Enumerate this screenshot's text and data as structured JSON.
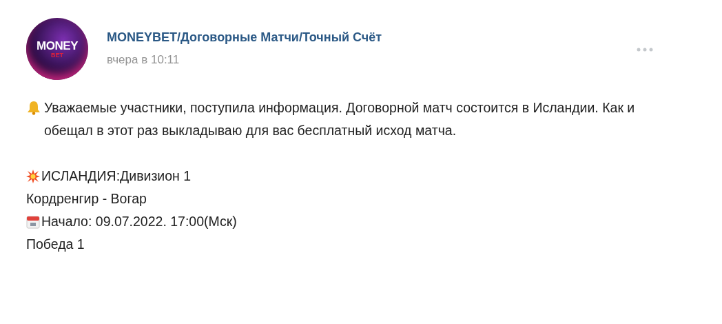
{
  "post": {
    "avatar": {
      "line1": "MONEY",
      "line2": "BET"
    },
    "author": "MONEYBET/Договорные Матчи/Точный Счёт",
    "time": "вчера в 10:11",
    "intro": "Уважаемые участники, поступила информация. Договорной матч состоится в Исландии. Как и обещал в этот раз выкладываю для вас бесплатный исход матча.",
    "lines": [
      {
        "kind": "league",
        "text": "ИСЛАНДИЯ:Дивизион 1"
      },
      {
        "kind": "plain",
        "text": "Кордренгир - Вогар"
      },
      {
        "kind": "date",
        "text": "Начало: 09.07.2022. 17:00(Мск)"
      },
      {
        "kind": "plain",
        "text": "Победа 1"
      }
    ]
  }
}
